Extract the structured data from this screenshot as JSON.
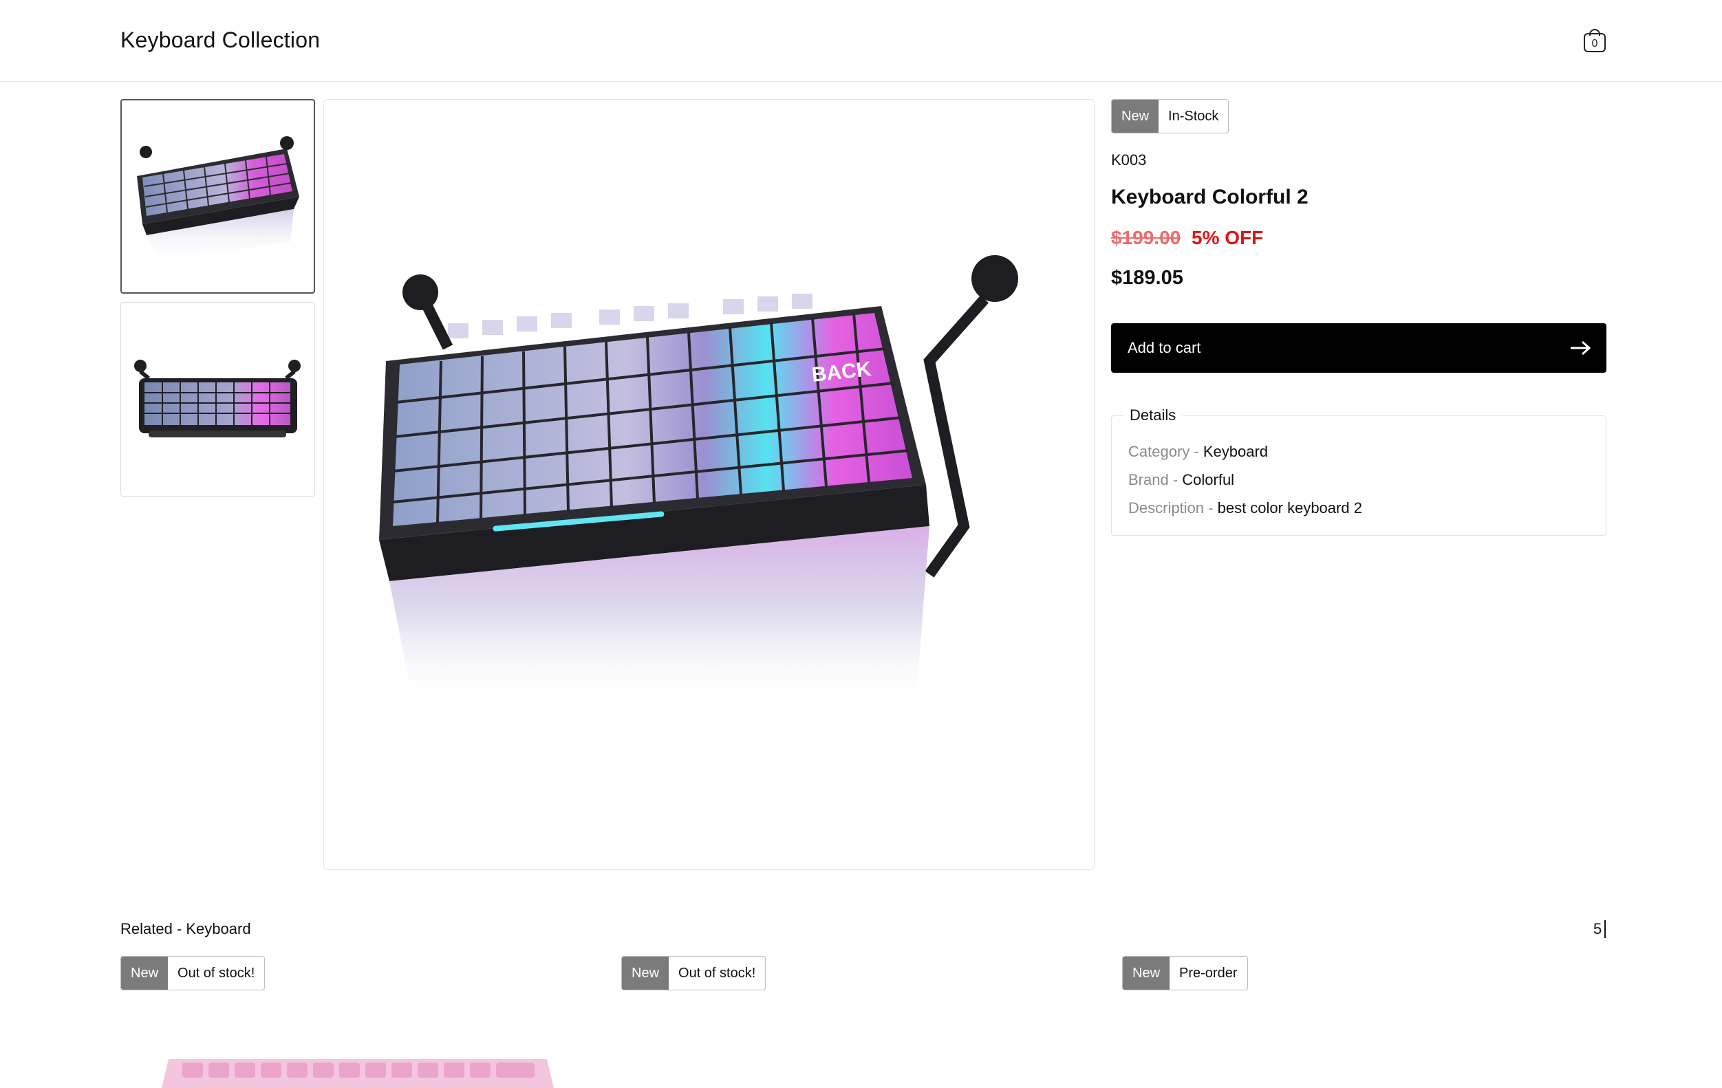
{
  "header": {
    "brand": "Keyboard Collection",
    "cart_count": "0",
    "cart_icon": "shopping-bag-icon"
  },
  "gallery": {
    "thumbnails": [
      {
        "label": "keyboard thumbnail 1",
        "active": true
      },
      {
        "label": "keyboard thumbnail 2",
        "active": false
      }
    ]
  },
  "product": {
    "badge_new": "New",
    "badge_status": "In-Stock",
    "sku": "K003",
    "title": "Keyboard Colorful 2",
    "old_price": "$199.00",
    "discount": "5% OFF",
    "price": "$189.05",
    "add_to_cart": "Add to cart",
    "add_to_cart_icon": "arrow-right-icon",
    "details_title": "Details",
    "details": [
      {
        "key": "Category - ",
        "value": "Keyboard"
      },
      {
        "key": "Brand - ",
        "value": "Colorful"
      },
      {
        "key": "Description - ",
        "value": "best color keyboard 2"
      }
    ]
  },
  "related": {
    "title": "Related - Keyboard",
    "count": "5",
    "cards": [
      {
        "badge_new": "New",
        "badge_status": "Out of stock!"
      },
      {
        "badge_new": "New",
        "badge_status": "Out of stock!"
      },
      {
        "badge_new": "New",
        "badge_status": "Pre-order"
      }
    ]
  },
  "colors": {
    "accent": "#000000",
    "badge_grey": "#7b7b7b",
    "discount_red": "#e01414",
    "old_price_red": "#f06a6a"
  }
}
